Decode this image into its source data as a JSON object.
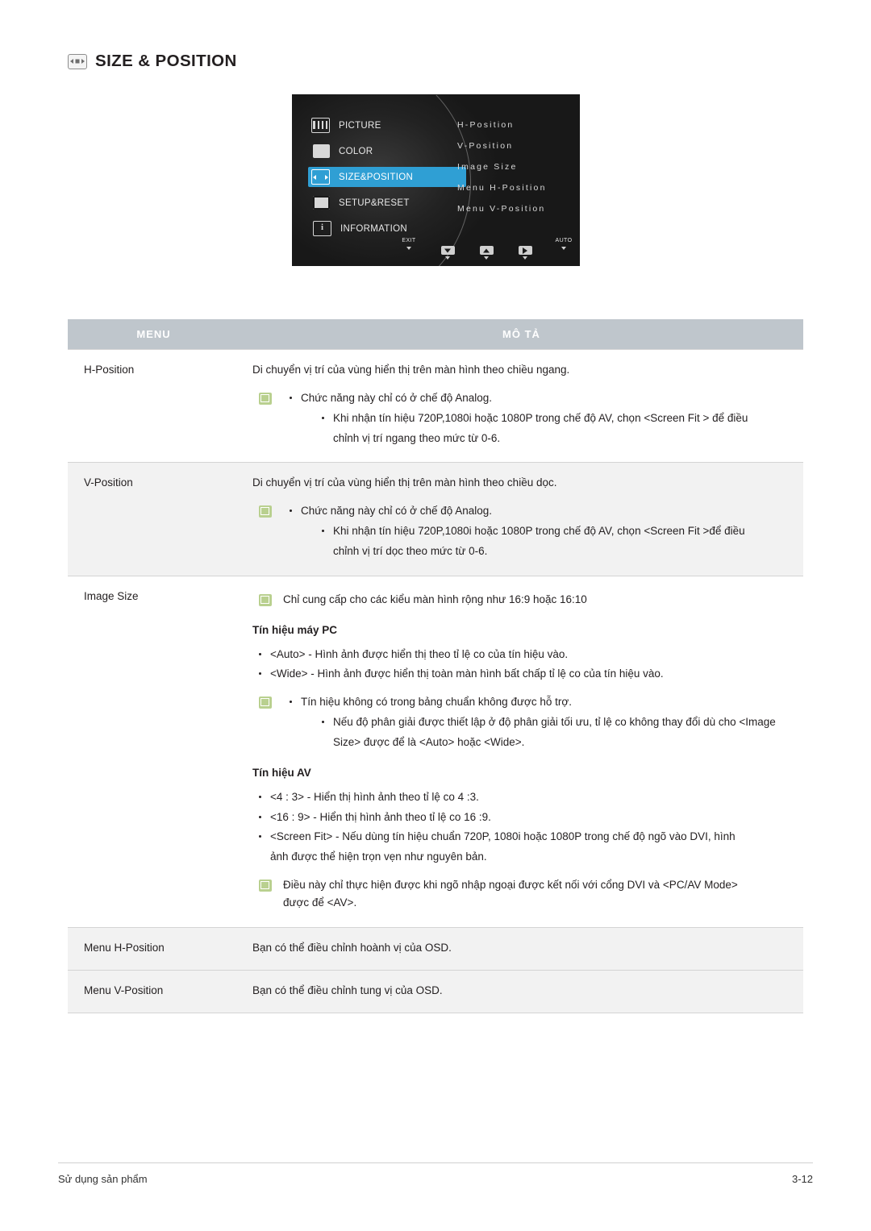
{
  "header": {
    "icon": "size-position-icon",
    "title": "SIZE & POSITION"
  },
  "osd": {
    "menu_items": [
      {
        "icon": "picture-icon",
        "label": "PICTURE",
        "selected": false
      },
      {
        "icon": "color-icon",
        "label": "COLOR",
        "selected": false
      },
      {
        "icon": "size-position-icon",
        "label": "SIZE&POSITION",
        "selected": true
      },
      {
        "icon": "setup-reset-icon",
        "label": "SETUP&RESET",
        "selected": false
      },
      {
        "icon": "information-icon",
        "label": "INFORMATION",
        "selected": false
      }
    ],
    "submenu_items": [
      "H-Position",
      "V-Position",
      "Image Size",
      "Menu H-Position",
      "Menu V-Position"
    ],
    "buttons": [
      {
        "caption": "EXIT",
        "icon": "exit-icon"
      },
      {
        "caption": "",
        "icon": "arrow-down-icon"
      },
      {
        "caption": "",
        "icon": "arrow-up-icon"
      },
      {
        "caption": "",
        "icon": "arrow-right-icon"
      },
      {
        "caption": "AUTO",
        "icon": "auto-icon"
      },
      {
        "caption": "",
        "icon": "power-icon"
      }
    ]
  },
  "table": {
    "headers": {
      "menu": "MENU",
      "description": "MÔ TẢ"
    },
    "rows": [
      {
        "menu": "H-Position",
        "intro": "Di chuyển vị trí của vùng hiển thị trên màn hình theo chiều ngang.",
        "note_bullet": "Chức năng này chỉ có ở chế độ Analog.",
        "indent_bullet_1": "Khi nhận tín hiệu 720P,1080i hoặc 1080P trong chế độ AV, chọn <Screen Fit  > để điều",
        "indent_bullet_2": "chỉnh vị trí ngang theo mức từ 0-6."
      },
      {
        "menu": "V-Position",
        "intro": "Di chuyển vị trí của vùng hiển thị trên màn hình theo chiều dọc.",
        "note_bullet": "Chức năng này chỉ có ở chế độ Analog.",
        "indent_bullet_1": "Khi nhận tín hiệu 720P,1080i hoặc 1080P trong chế độ AV, chọn <Screen Fit  >để điều",
        "indent_bullet_2": "chỉnh vị trí dọc theo mức từ 0-6."
      },
      {
        "menu": "Image Size",
        "note_top": "Chỉ cung cấp cho các kiểu màn hình rộng như 16:9 hoặc 16:10",
        "sub_pc": "Tín hiệu máy PC",
        "pc_bullets": [
          "<Auto> - Hình ảnh được hiển thị theo tỉ lệ co của tín hiệu vào.",
          "<Wide> - Hình ảnh được hiển thị toàn màn hình bất chấp tỉ lệ co của tín hiệu vào."
        ],
        "note_pc_bullet": "Tín hiệu không có trong bảng chuẩn không được hỗ trợ.",
        "note_pc_indent_1": "Nếu độ phân giải được thiết lập ở độ phân giải tối ưu, tỉ lệ co không thay đổi dù cho <Image",
        "note_pc_indent_2": "Size> được để là <Auto> hoặc <Wide>.",
        "sub_av": "Tín hiệu AV",
        "av_bullets": [
          "<4 : 3> - Hiển thị hình ảnh theo tỉ lệ co 4 :3.",
          "<16 : 9> - Hiển thị hình ảnh theo tỉ lệ co 16 :9."
        ],
        "av_bullet_3_line1": "<Screen Fit> - Nếu dùng tín hiệu chuẩn 720P, 1080i hoặc 1080P trong chế độ ngõ vào DVI, hình",
        "av_bullet_3_line2": "ảnh được thể hiện trọn vẹn như nguyên bản.",
        "note_av_line1": "Điều này chỉ thực hiện được khi ngõ nhập ngoại được kết nối với cổng DVI và <PC/AV Mode>",
        "note_av_line2": "được để <AV>."
      },
      {
        "menu": "Menu H-Position",
        "intro": "Bạn có thể điều chỉnh hoành vị của OSD."
      },
      {
        "menu": "Menu V-Position",
        "intro": "Bạn có thể điều chỉnh tung vị của OSD."
      }
    ]
  },
  "footer": {
    "left": "Sử dụng sản phẩm",
    "right": "3-12"
  }
}
